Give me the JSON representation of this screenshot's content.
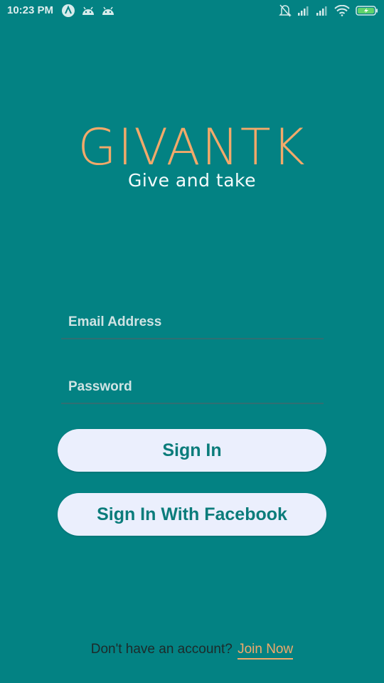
{
  "status_bar": {
    "time": "10:23 PM",
    "left_icons": [
      "app-a-icon",
      "android-icon",
      "android-icon"
    ],
    "right_icons": [
      "bell-off-icon",
      "signal-icon",
      "signal-icon",
      "wifi-icon",
      "battery-charging-icon"
    ]
  },
  "brand": {
    "title": "GIVANTK",
    "tagline": "Give and take",
    "title_color": "#f2a96a"
  },
  "form": {
    "email_placeholder": "Email Address",
    "email_value": "",
    "password_placeholder": "Password",
    "password_value": ""
  },
  "buttons": {
    "sign_in": "Sign In",
    "sign_in_facebook": "Sign In With Facebook"
  },
  "footer": {
    "prompt": "Don't have an account?",
    "join_link": "Join Now"
  },
  "colors": {
    "background": "#038283",
    "button_bg": "#ebeffd",
    "button_text": "#0b7c7b",
    "accent": "#f2a96a"
  }
}
